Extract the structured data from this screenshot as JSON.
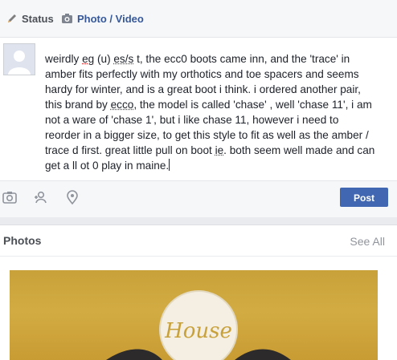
{
  "composer": {
    "tabs": [
      {
        "label": "Status",
        "icon": "pencil-icon"
      },
      {
        "label": "Photo / Video",
        "icon": "camera-icon"
      }
    ],
    "text_lines": [
      [
        "weirdly  ",
        {
          "spell": "eg"
        },
        " (u) ",
        {
          "spell": "es/s"
        },
        " t, the ecc0 boots came inn, and the 'trace' in"
      ],
      [
        "amber fits perfectly with my orthotics and toe spacers and seems"
      ],
      [
        "hardy for winter, and is a great boot i think. i ordered another pair,"
      ],
      [
        "this brand by ",
        {
          "spell": "ecco"
        },
        ", the model is called 'chase' , well 'chase 11', i am"
      ],
      [
        "not a ware of 'chase 1', but i like chase 11, however i need to"
      ],
      [
        "reorder in a bigger size, to get this style to fit as well as the amber /"
      ],
      [
        "trace d first. great little pull on boot ",
        {
          "spell": "ie"
        },
        ". both seem well made and can"
      ],
      [
        "get a ll ot 0 play in maine."
      ]
    ],
    "actions": [
      {
        "icon": "camera-icon"
      },
      {
        "icon": "tag-friends-icon"
      },
      {
        "icon": "location-pin-icon"
      }
    ],
    "post_label": "Post"
  },
  "photos": {
    "title": "Photos",
    "see_all_label": "See All",
    "image_text": "House"
  },
  "colors": {
    "brand_blue": "#4267b2",
    "link_blue": "#365899",
    "photo_gold": "#c9a13a"
  }
}
